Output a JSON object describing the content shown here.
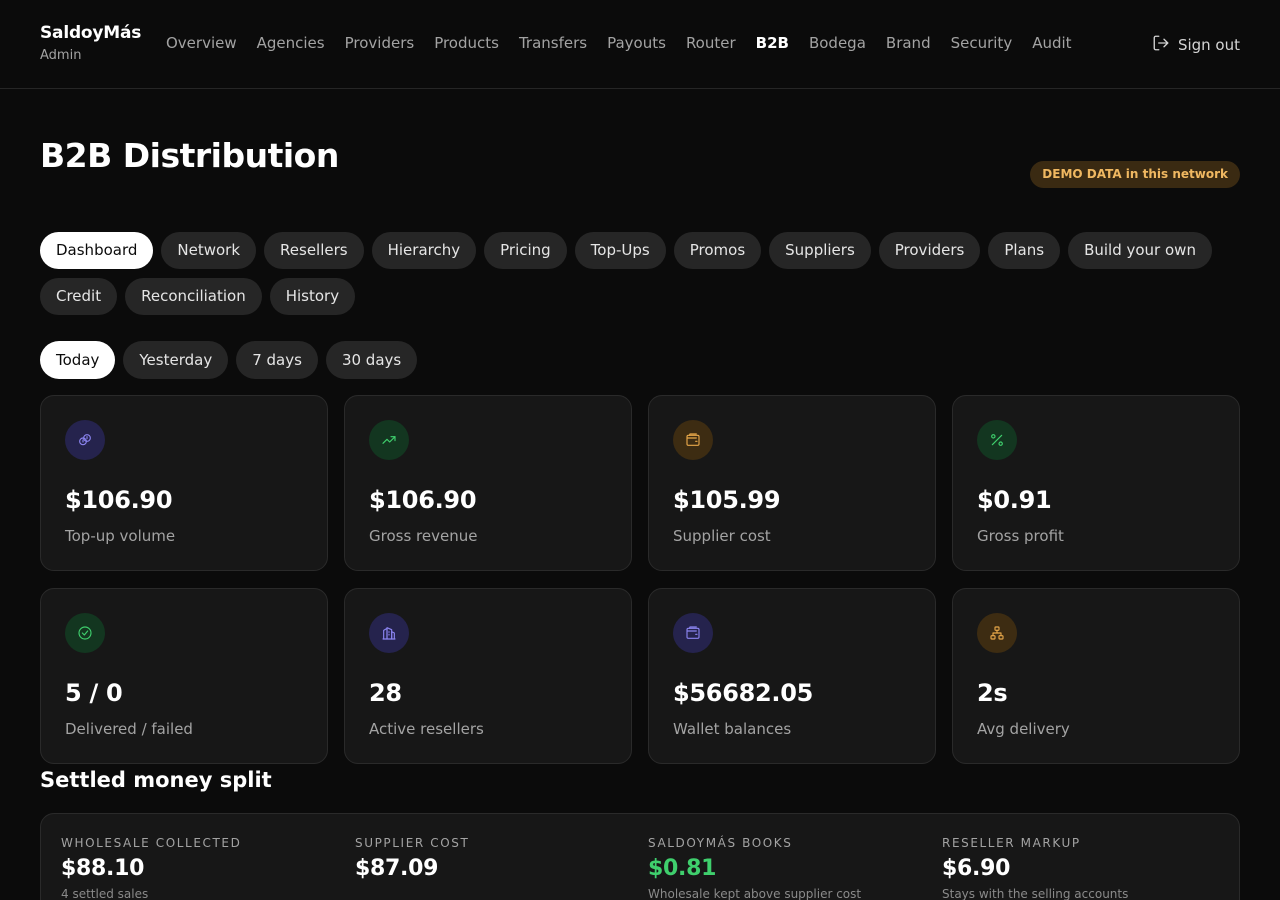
{
  "app": {
    "name": "SaldoyMás",
    "role": "Admin"
  },
  "nav": {
    "items": [
      "Overview",
      "Agencies",
      "Providers",
      "Products",
      "Transfers",
      "Payouts",
      "Router",
      "B2B",
      "Bodega",
      "Brand",
      "Security",
      "Audit"
    ],
    "active": "B2B",
    "sign_out": "Sign out"
  },
  "page": {
    "title": "B2B Distribution",
    "badge": "DEMO DATA in this network"
  },
  "tabs": {
    "items": [
      "Dashboard",
      "Network",
      "Resellers",
      "Hierarchy",
      "Pricing",
      "Top-Ups",
      "Promos",
      "Suppliers",
      "Providers",
      "Plans",
      "Build your own",
      "Credit",
      "Reconciliation",
      "History"
    ],
    "active": "Dashboard"
  },
  "periods": {
    "items": [
      "Today",
      "Yesterday",
      "7 days",
      "30 days"
    ],
    "active": "Today"
  },
  "stats": [
    {
      "icon": "link-coins-icon",
      "tone": "indigo",
      "value": "$106.90",
      "label": "Top-up volume"
    },
    {
      "icon": "trending-up-icon",
      "tone": "green",
      "value": "$106.90",
      "label": "Gross revenue"
    },
    {
      "icon": "wallet-icon",
      "tone": "amber",
      "value": "$105.99",
      "label": "Supplier cost"
    },
    {
      "icon": "percent-icon",
      "tone": "green",
      "value": "$0.91",
      "label": "Gross profit"
    },
    {
      "icon": "check-circle-icon",
      "tone": "green",
      "value": "5 / 0",
      "label": "Delivered / failed"
    },
    {
      "icon": "building-icon",
      "tone": "indigo",
      "value": "28",
      "label": "Active resellers"
    },
    {
      "icon": "wallet-icon",
      "tone": "indigo",
      "value": "$56682.05",
      "label": "Wallet balances"
    },
    {
      "icon": "network-icon",
      "tone": "amber",
      "value": "2s",
      "label": "Avg delivery"
    }
  ],
  "split": {
    "title": "Settled money split",
    "columns": [
      {
        "label": "Wholesale collected",
        "value": "$88.10",
        "note": "4 settled sales",
        "highlight": false
      },
      {
        "label": "Supplier cost",
        "value": "$87.09",
        "note": "",
        "highlight": false
      },
      {
        "label": "SaldoyMás books",
        "value": "$0.81",
        "note": "Wholesale kept above supplier cost",
        "highlight": true
      },
      {
        "label": "Reseller markup",
        "value": "$6.90",
        "note": "Stays with the selling accounts",
        "highlight": false
      }
    ]
  }
}
